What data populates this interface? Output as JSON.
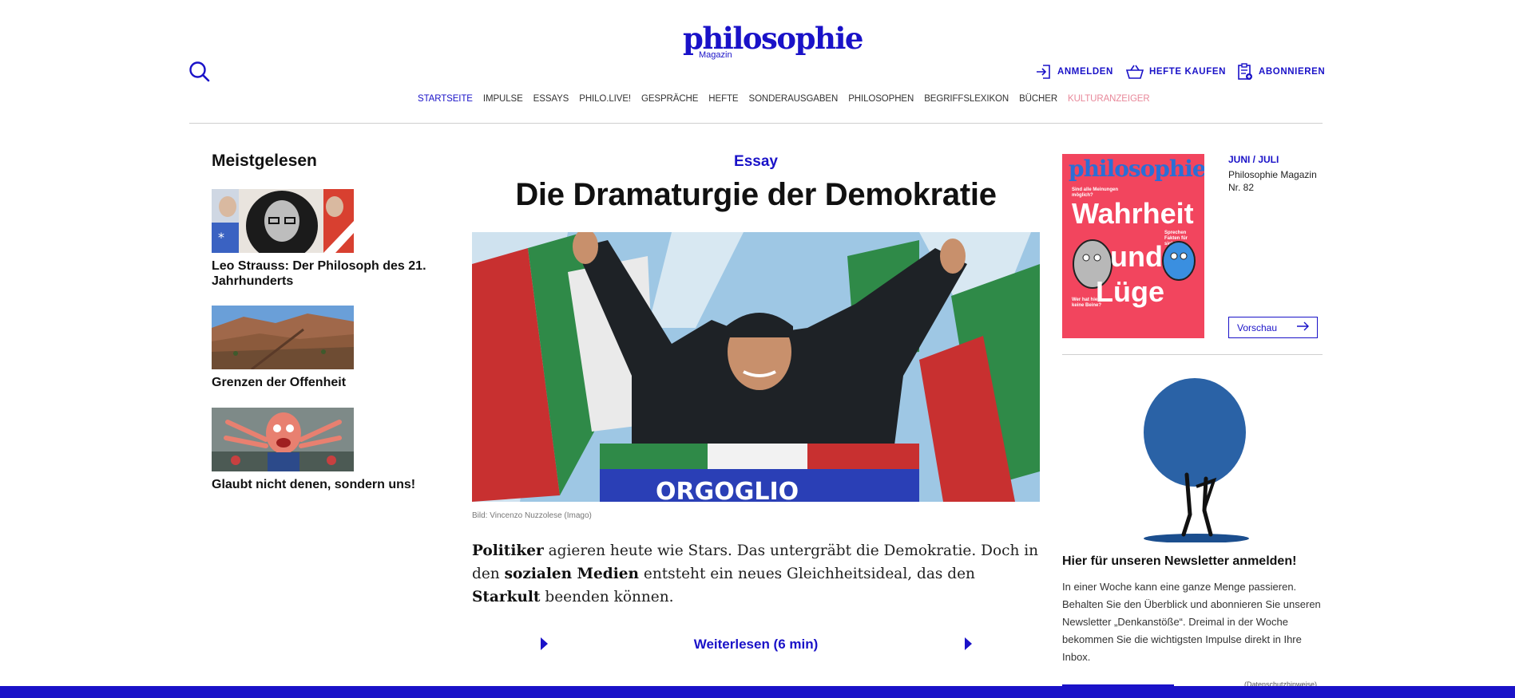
{
  "header": {
    "logo_word": "philosophie",
    "logo_sub": "Magazin",
    "account": [
      {
        "label": "ANMELDEN",
        "icon": "login-icon"
      },
      {
        "label": "HEFTE KAUFEN",
        "icon": "basket-icon"
      },
      {
        "label": "ABONNIEREN",
        "icon": "subscribe-icon"
      }
    ]
  },
  "nav": {
    "items": [
      "STARTSEITE",
      "IMPULSE",
      "ESSAYS",
      "PHILO.LIVE!",
      "GESPRÄCHE",
      "HEFTE",
      "SONDERAUSGABEN",
      "PHILOSOPHEN",
      "BEGRIFFSLEXIKON",
      "BÜCHER",
      "KULTURANZEIGER"
    ],
    "active": "STARTSEITE",
    "colors": {
      "active": "#1a12c8",
      "default": "#333333",
      "highlight": "#e8889a"
    }
  },
  "most_read": {
    "title": "Meistgelesen",
    "items": [
      {
        "title": "Leo Strauss: Der Philosoph des 21. Jahrhunderts"
      },
      {
        "title": "Grenzen der Offenheit"
      },
      {
        "title": "Glaubt nicht denen, sondern uns!"
      }
    ]
  },
  "article": {
    "kicker": "Essay",
    "headline": "Die Dramaturgie der Demokratie",
    "image_text": "ORGOGLIO",
    "credit": "Bild: Vincenzo Nuzzolese (Imago)",
    "lede": [
      {
        "b": "Politiker",
        "t": " agieren heute wie Stars. Das untergräbt die Demokratie. Doch in den "
      },
      {
        "b": "sozialen Medien",
        "t": " entsteht ein neues Gleichheitsideal, das den "
      },
      {
        "b": "Starkult",
        "t": " beenden können."
      }
    ],
    "read_more": "Weiterlesen (6 min)"
  },
  "issue": {
    "cover_logo": "philosophie",
    "cover_teaser": "Sind alle Meinungen möglich?",
    "cover_side": "Sprechen Fakten für sich?",
    "cover_word1": "Wahrheit",
    "cover_word2": "und",
    "cover_word3": "Lüge",
    "cover_bottom": "Wer hat hier keine Beine?",
    "date": "JUNI / JULI",
    "name": "Philosophie Magazin Nr. 82",
    "preview": "Vorschau"
  },
  "newsletter": {
    "title": "Hier für unseren Newsletter anmelden!",
    "text": "In einer Woche kann eine ganze Menge passieren. Behalten Sie den Überblick und abonnieren Sie unseren Newsletter „Denkanstöße“. Dreimal in der Woche bekommen Sie die wichtigsten Impulse direkt in Ihre Inbox.",
    "privacy": "(Datenschutzhinweise)"
  },
  "colors": {
    "brand": "#1a12c8",
    "cover_bg": "#f2455e"
  }
}
